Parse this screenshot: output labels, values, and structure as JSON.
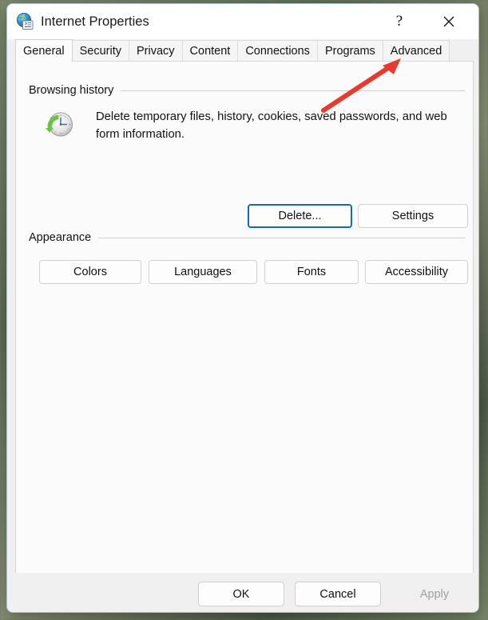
{
  "window": {
    "title": "Internet Properties",
    "icon": "internet-properties-globe-icon",
    "help_label": "?",
    "close_label": "✕"
  },
  "tabs": [
    {
      "label": "General",
      "active": true
    },
    {
      "label": "Security",
      "active": false
    },
    {
      "label": "Privacy",
      "active": false
    },
    {
      "label": "Content",
      "active": false
    },
    {
      "label": "Connections",
      "active": false
    },
    {
      "label": "Programs",
      "active": false
    },
    {
      "label": "Advanced",
      "active": false
    }
  ],
  "general": {
    "browsing_history": {
      "group_label": "Browsing history",
      "icon": "clock-refresh-icon",
      "description": "Delete temporary files, history, cookies, saved passwords, and web form information.",
      "delete_label": "Delete...",
      "settings_label": "Settings"
    },
    "appearance": {
      "group_label": "Appearance",
      "colors_label": "Colors",
      "languages_label": "Languages",
      "fonts_label": "Fonts",
      "accessibility_label": "Accessibility"
    }
  },
  "footer": {
    "ok_label": "OK",
    "cancel_label": "Cancel",
    "apply_label": "Apply"
  },
  "annotation": {
    "type": "red-arrow",
    "points_to": "Advanced",
    "color": "#e63b2e"
  },
  "colors": {
    "focus_accent": "#0f6cbd",
    "dialog_bg": "#f0f0f0",
    "panel_bg": "#fbfbfb",
    "disabled_text": "#a0a0a0"
  }
}
